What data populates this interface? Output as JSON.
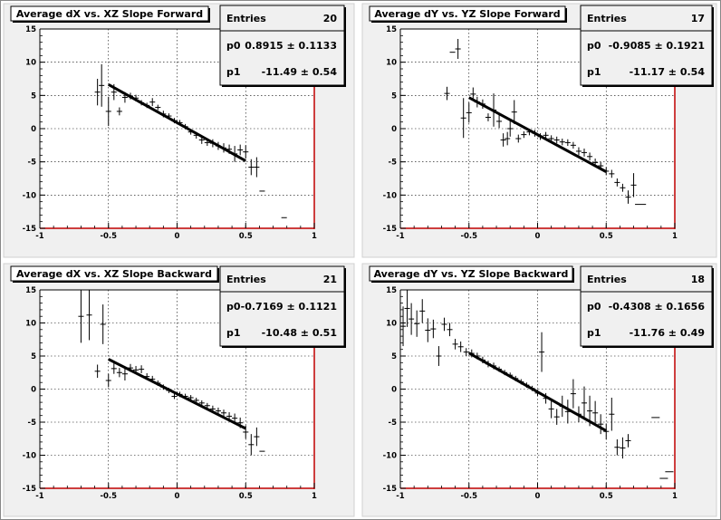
{
  "colors": {
    "pad_background": "#f0f0f0",
    "frame_background": "#ffffff",
    "axis_line": "#000000",
    "frame_right_bottom": "#c00000",
    "grid": "#000000",
    "fit_line": "#000000",
    "box_border": "#000000"
  },
  "chart_data": [
    {
      "type": "scatter",
      "title": "Average dX vs. XZ Slope Forward",
      "xlim": [
        -1,
        1
      ],
      "ylim": [
        -15,
        15
      ],
      "xticks": [
        -1,
        -0.5,
        0,
        0.5,
        1
      ],
      "yticks": [
        -15,
        -10,
        -5,
        0,
        5,
        10,
        15
      ],
      "grid": true,
      "stats": {
        "entries_label": "Entries",
        "entries_value": "20",
        "p0_label": "p0",
        "p0_value": "0.8915 ± 0.1133",
        "p1_label": "p1",
        "p1_value": "-11.49 ± 0.54"
      },
      "fit": {
        "x_start": -0.5,
        "x_end": 0.5,
        "p0": 0.8915,
        "p1": -11.49
      },
      "points": [
        {
          "x": -0.58,
          "y": 5.5,
          "ex": 0.02,
          "ey": 2.0
        },
        {
          "x": -0.55,
          "y": 6.5,
          "ex": 0.02,
          "ey": 3.2
        },
        {
          "x": -0.5,
          "y": 2.6,
          "ex": 0.02,
          "ey": 2.2
        },
        {
          "x": -0.46,
          "y": 5.5,
          "ex": 0.02,
          "ey": 1.2
        },
        {
          "x": -0.42,
          "y": 2.6,
          "ex": 0.02,
          "ey": 0.6
        },
        {
          "x": -0.38,
          "y": 4.7,
          "ex": 0.02,
          "ey": 0.8
        },
        {
          "x": -0.34,
          "y": 4.9,
          "ex": 0.02,
          "ey": 0.5
        },
        {
          "x": -0.3,
          "y": 4.6,
          "ex": 0.02,
          "ey": 0.5
        },
        {
          "x": -0.26,
          "y": 3.9,
          "ex": 0.02,
          "ey": 0.4
        },
        {
          "x": -0.22,
          "y": 3.5,
          "ex": 0.02,
          "ey": 0.4
        },
        {
          "x": -0.18,
          "y": 4.0,
          "ex": 0.02,
          "ey": 0.6
        },
        {
          "x": -0.14,
          "y": 3.2,
          "ex": 0.02,
          "ey": 0.4
        },
        {
          "x": -0.1,
          "y": 2.2,
          "ex": 0.02,
          "ey": 0.5
        },
        {
          "x": -0.06,
          "y": 1.9,
          "ex": 0.02,
          "ey": 0.4
        },
        {
          "x": -0.02,
          "y": 1.2,
          "ex": 0.02,
          "ey": 0.4
        },
        {
          "x": 0.02,
          "y": 0.9,
          "ex": 0.02,
          "ey": 0.4
        },
        {
          "x": 0.06,
          "y": 0.3,
          "ex": 0.02,
          "ey": 0.4
        },
        {
          "x": 0.1,
          "y": -0.5,
          "ex": 0.02,
          "ey": 0.4
        },
        {
          "x": 0.14,
          "y": -1.0,
          "ex": 0.02,
          "ey": 0.5
        },
        {
          "x": 0.18,
          "y": -1.7,
          "ex": 0.02,
          "ey": 0.6
        },
        {
          "x": 0.22,
          "y": -2.1,
          "ex": 0.02,
          "ey": 0.5
        },
        {
          "x": 0.26,
          "y": -2.2,
          "ex": 0.02,
          "ey": 0.6
        },
        {
          "x": 0.3,
          "y": -2.6,
          "ex": 0.02,
          "ey": 0.6
        },
        {
          "x": 0.34,
          "y": -2.9,
          "ex": 0.02,
          "ey": 0.7
        },
        {
          "x": 0.38,
          "y": -3.1,
          "ex": 0.02,
          "ey": 0.7
        },
        {
          "x": 0.42,
          "y": -3.8,
          "ex": 0.02,
          "ey": 1.2
        },
        {
          "x": 0.46,
          "y": -3.2,
          "ex": 0.02,
          "ey": 0.8
        },
        {
          "x": 0.5,
          "y": -3.5,
          "ex": 0.02,
          "ey": 1.0
        },
        {
          "x": 0.54,
          "y": -5.8,
          "ex": 0.02,
          "ey": 1.2
        },
        {
          "x": 0.58,
          "y": -5.8,
          "ex": 0.02,
          "ey": 1.5
        },
        {
          "x": 0.62,
          "y": -9.4,
          "ex": 0.02,
          "ey": 0.0
        },
        {
          "x": 0.78,
          "y": -13.4,
          "ex": 0.02,
          "ey": 0.0
        }
      ]
    },
    {
      "type": "scatter",
      "title": "Average dY vs. YZ Slope Forward",
      "xlim": [
        -1,
        1
      ],
      "ylim": [
        -15,
        15
      ],
      "xticks": [
        -1,
        -0.5,
        0,
        0.5,
        1
      ],
      "yticks": [
        -15,
        -10,
        -5,
        0,
        5,
        10,
        15
      ],
      "grid": true,
      "stats": {
        "entries_label": "Entries",
        "entries_value": "17",
        "p0_label": "p0",
        "p0_value": "-0.9085 ± 0.1921",
        "p1_label": "p1",
        "p1_value": "-11.17 ± 0.54"
      },
      "fit": {
        "x_start": -0.5,
        "x_end": 0.5,
        "p0": -0.9085,
        "p1": -11.17
      },
      "points": [
        {
          "x": -0.66,
          "y": 5.3,
          "ex": 0.02,
          "ey": 1.0
        },
        {
          "x": -0.62,
          "y": 11.5,
          "ex": 0.02,
          "ey": 0.0
        },
        {
          "x": -0.58,
          "y": 12.0,
          "ex": 0.02,
          "ey": 1.5
        },
        {
          "x": -0.54,
          "y": 1.6,
          "ex": 0.02,
          "ey": 3.0
        },
        {
          "x": -0.5,
          "y": 2.4,
          "ex": 0.02,
          "ey": 1.5
        },
        {
          "x": -0.47,
          "y": 5.2,
          "ex": 0.02,
          "ey": 1.0
        },
        {
          "x": -0.44,
          "y": 4.0,
          "ex": 0.02,
          "ey": 0.8
        },
        {
          "x": -0.4,
          "y": 3.7,
          "ex": 0.02,
          "ey": 0.7
        },
        {
          "x": -0.36,
          "y": 1.7,
          "ex": 0.02,
          "ey": 0.6
        },
        {
          "x": -0.32,
          "y": 2.8,
          "ex": 0.02,
          "ey": 2.5
        },
        {
          "x": -0.28,
          "y": 1.1,
          "ex": 0.02,
          "ey": 1.0
        },
        {
          "x": -0.25,
          "y": -1.7,
          "ex": 0.02,
          "ey": 1.0
        },
        {
          "x": -0.22,
          "y": -1.5,
          "ex": 0.02,
          "ey": 1.0
        },
        {
          "x": -0.2,
          "y": 0.0,
          "ex": 0.02,
          "ey": 1.2
        },
        {
          "x": -0.17,
          "y": 2.5,
          "ex": 0.02,
          "ey": 1.8
        },
        {
          "x": -0.14,
          "y": -1.5,
          "ex": 0.02,
          "ey": 0.6
        },
        {
          "x": -0.1,
          "y": -0.9,
          "ex": 0.02,
          "ey": 0.5
        },
        {
          "x": -0.06,
          "y": -0.5,
          "ex": 0.02,
          "ey": 0.5
        },
        {
          "x": -0.02,
          "y": -0.7,
          "ex": 0.02,
          "ey": 0.5
        },
        {
          "x": 0.02,
          "y": -1.2,
          "ex": 0.02,
          "ey": 0.5
        },
        {
          "x": 0.06,
          "y": -1.0,
          "ex": 0.02,
          "ey": 0.5
        },
        {
          "x": 0.1,
          "y": -1.5,
          "ex": 0.02,
          "ey": 0.5
        },
        {
          "x": 0.14,
          "y": -1.7,
          "ex": 0.02,
          "ey": 0.5
        },
        {
          "x": 0.18,
          "y": -2.0,
          "ex": 0.02,
          "ey": 0.5
        },
        {
          "x": 0.22,
          "y": -2.1,
          "ex": 0.02,
          "ey": 0.5
        },
        {
          "x": 0.26,
          "y": -2.5,
          "ex": 0.02,
          "ey": 0.5
        },
        {
          "x": 0.3,
          "y": -3.4,
          "ex": 0.02,
          "ey": 0.6
        },
        {
          "x": 0.34,
          "y": -3.6,
          "ex": 0.02,
          "ey": 0.6
        },
        {
          "x": 0.38,
          "y": -4.2,
          "ex": 0.02,
          "ey": 0.6
        },
        {
          "x": 0.42,
          "y": -5.1,
          "ex": 0.02,
          "ey": 0.6
        },
        {
          "x": 0.46,
          "y": -5.6,
          "ex": 0.02,
          "ey": 0.6
        },
        {
          "x": 0.5,
          "y": -6.4,
          "ex": 0.02,
          "ey": 0.6
        },
        {
          "x": 0.54,
          "y": -6.8,
          "ex": 0.02,
          "ey": 0.6
        },
        {
          "x": 0.58,
          "y": -8.1,
          "ex": 0.02,
          "ey": 0.6
        },
        {
          "x": 0.62,
          "y": -8.9,
          "ex": 0.02,
          "ey": 0.6
        },
        {
          "x": 0.66,
          "y": -10.3,
          "ex": 0.02,
          "ey": 1.0
        },
        {
          "x": 0.7,
          "y": -8.5,
          "ex": 0.02,
          "ey": 1.8
        },
        {
          "x": 0.75,
          "y": -11.4,
          "ex": 0.04,
          "ey": 0.0
        }
      ]
    },
    {
      "type": "scatter",
      "title": "Average dX vs. XZ Slope Backward",
      "xlim": [
        -1,
        1
      ],
      "ylim": [
        -15,
        15
      ],
      "xticks": [
        -1,
        -0.5,
        0,
        0.5,
        1
      ],
      "yticks": [
        -15,
        -10,
        -5,
        0,
        5,
        10,
        15
      ],
      "grid": true,
      "stats": {
        "entries_label": "Entries",
        "entries_value": "21",
        "p0_label": "p0",
        "p0_value": "-0.7169 ± 0.1121",
        "p1_label": "p1",
        "p1_value": "-10.48 ± 0.51"
      },
      "fit": {
        "x_start": -0.5,
        "x_end": 0.5,
        "p0": -0.7169,
        "p1": -10.48
      },
      "points": [
        {
          "x": -0.7,
          "y": 11.0,
          "ex": 0.02,
          "ey": 4.0
        },
        {
          "x": -0.64,
          "y": 11.2,
          "ex": 0.02,
          "ey": 3.8
        },
        {
          "x": -0.58,
          "y": 2.7,
          "ex": 0.02,
          "ey": 1.0
        },
        {
          "x": -0.54,
          "y": 9.8,
          "ex": 0.02,
          "ey": 3.0
        },
        {
          "x": -0.5,
          "y": 1.3,
          "ex": 0.02,
          "ey": 1.0
        },
        {
          "x": -0.46,
          "y": 3.1,
          "ex": 0.02,
          "ey": 0.8
        },
        {
          "x": -0.42,
          "y": 2.5,
          "ex": 0.02,
          "ey": 0.7
        },
        {
          "x": -0.38,
          "y": 2.3,
          "ex": 0.02,
          "ey": 1.0
        },
        {
          "x": -0.34,
          "y": 3.2,
          "ex": 0.02,
          "ey": 0.6
        },
        {
          "x": -0.3,
          "y": 2.9,
          "ex": 0.02,
          "ey": 0.6
        },
        {
          "x": -0.26,
          "y": 3.0,
          "ex": 0.02,
          "ey": 0.6
        },
        {
          "x": -0.22,
          "y": 1.9,
          "ex": 0.02,
          "ey": 0.5
        },
        {
          "x": -0.18,
          "y": 1.5,
          "ex": 0.02,
          "ey": 0.5
        },
        {
          "x": -0.14,
          "y": 0.9,
          "ex": 0.02,
          "ey": 0.4
        },
        {
          "x": -0.1,
          "y": 0.3,
          "ex": 0.02,
          "ey": 0.4
        },
        {
          "x": -0.06,
          "y": -0.2,
          "ex": 0.02,
          "ey": 0.4
        },
        {
          "x": -0.02,
          "y": -1.1,
          "ex": 0.02,
          "ey": 0.4
        },
        {
          "x": 0.02,
          "y": -0.8,
          "ex": 0.02,
          "ey": 0.4
        },
        {
          "x": 0.06,
          "y": -1.1,
          "ex": 0.02,
          "ey": 0.4
        },
        {
          "x": 0.1,
          "y": -1.3,
          "ex": 0.02,
          "ey": 0.4
        },
        {
          "x": 0.14,
          "y": -1.7,
          "ex": 0.02,
          "ey": 0.4
        },
        {
          "x": 0.18,
          "y": -2.1,
          "ex": 0.02,
          "ey": 0.4
        },
        {
          "x": 0.22,
          "y": -2.5,
          "ex": 0.02,
          "ey": 0.4
        },
        {
          "x": 0.26,
          "y": -3.0,
          "ex": 0.02,
          "ey": 0.5
        },
        {
          "x": 0.3,
          "y": -3.3,
          "ex": 0.02,
          "ey": 0.5
        },
        {
          "x": 0.34,
          "y": -3.6,
          "ex": 0.02,
          "ey": 0.5
        },
        {
          "x": 0.38,
          "y": -4.1,
          "ex": 0.02,
          "ey": 0.6
        },
        {
          "x": 0.42,
          "y": -4.4,
          "ex": 0.02,
          "ey": 0.7
        },
        {
          "x": 0.46,
          "y": -5.1,
          "ex": 0.02,
          "ey": 0.8
        },
        {
          "x": 0.5,
          "y": -6.5,
          "ex": 0.02,
          "ey": 1.0
        },
        {
          "x": 0.54,
          "y": -8.4,
          "ex": 0.02,
          "ey": 1.6
        },
        {
          "x": 0.58,
          "y": -7.2,
          "ex": 0.02,
          "ey": 1.4
        },
        {
          "x": 0.62,
          "y": -9.4,
          "ex": 0.02,
          "ey": 0.0
        }
      ]
    },
    {
      "type": "scatter",
      "title": "Average dY vs. YZ Slope Backward",
      "xlim": [
        -1,
        1
      ],
      "ylim": [
        -15,
        15
      ],
      "xticks": [
        -1,
        -0.5,
        0,
        0.5,
        1
      ],
      "yticks": [
        -15,
        -10,
        -5,
        0,
        5,
        10,
        15
      ],
      "grid": true,
      "stats": {
        "entries_label": "Entries",
        "entries_value": "18",
        "p0_label": "p0",
        "p0_value": "-0.4308 ± 0.1656",
        "p1_label": "p1",
        "p1_value": "-11.76 ± 0.49"
      },
      "fit": {
        "x_start": -0.5,
        "x_end": 0.5,
        "p0": -0.4308,
        "p1": -11.76
      },
      "points": [
        {
          "x": -0.98,
          "y": 9.5,
          "ex": 0.02,
          "ey": 3.0
        },
        {
          "x": -0.95,
          "y": 12.2,
          "ex": 0.02,
          "ey": 2.8
        },
        {
          "x": -0.92,
          "y": 10.6,
          "ex": 0.02,
          "ey": 2.4
        },
        {
          "x": -0.88,
          "y": 9.9,
          "ex": 0.02,
          "ey": 2.0
        },
        {
          "x": -0.84,
          "y": 11.8,
          "ex": 0.02,
          "ey": 1.8
        },
        {
          "x": -0.8,
          "y": 8.9,
          "ex": 0.02,
          "ey": 1.8
        },
        {
          "x": -0.76,
          "y": 9.1,
          "ex": 0.02,
          "ey": 1.4
        },
        {
          "x": -0.72,
          "y": 5.0,
          "ex": 0.02,
          "ey": 1.5
        },
        {
          "x": -0.68,
          "y": 9.8,
          "ex": 0.02,
          "ey": 1.0
        },
        {
          "x": -0.64,
          "y": 9.0,
          "ex": 0.02,
          "ey": 1.0
        },
        {
          "x": -0.6,
          "y": 6.8,
          "ex": 0.02,
          "ey": 0.8
        },
        {
          "x": -0.56,
          "y": 6.4,
          "ex": 0.02,
          "ey": 0.8
        },
        {
          "x": -0.52,
          "y": 5.6,
          "ex": 0.02,
          "ey": 0.6
        },
        {
          "x": -0.48,
          "y": 5.4,
          "ex": 0.02,
          "ey": 0.6
        },
        {
          "x": -0.44,
          "y": 5.0,
          "ex": 0.02,
          "ey": 0.5
        },
        {
          "x": -0.4,
          "y": 4.4,
          "ex": 0.02,
          "ey": 0.5
        },
        {
          "x": -0.36,
          "y": 3.8,
          "ex": 0.02,
          "ey": 0.5
        },
        {
          "x": -0.32,
          "y": 3.5,
          "ex": 0.02,
          "ey": 0.5
        },
        {
          "x": -0.28,
          "y": 3.0,
          "ex": 0.02,
          "ey": 0.4
        },
        {
          "x": -0.24,
          "y": 2.5,
          "ex": 0.02,
          "ey": 0.4
        },
        {
          "x": -0.2,
          "y": 2.1,
          "ex": 0.02,
          "ey": 0.4
        },
        {
          "x": -0.16,
          "y": 1.6,
          "ex": 0.02,
          "ey": 0.4
        },
        {
          "x": -0.12,
          "y": 1.1,
          "ex": 0.02,
          "ey": 0.4
        },
        {
          "x": -0.08,
          "y": 0.6,
          "ex": 0.02,
          "ey": 0.4
        },
        {
          "x": -0.04,
          "y": 0.1,
          "ex": 0.02,
          "ey": 0.4
        },
        {
          "x": 0.0,
          "y": -0.6,
          "ex": 0.02,
          "ey": 0.5
        },
        {
          "x": 0.03,
          "y": 5.6,
          "ex": 0.02,
          "ey": 3.0
        },
        {
          "x": 0.06,
          "y": -1.4,
          "ex": 0.02,
          "ey": 0.8
        },
        {
          "x": 0.1,
          "y": -3.0,
          "ex": 0.02,
          "ey": 1.4
        },
        {
          "x": 0.14,
          "y": -4.2,
          "ex": 0.02,
          "ey": 1.2
        },
        {
          "x": 0.18,
          "y": -2.6,
          "ex": 0.02,
          "ey": 1.6
        },
        {
          "x": 0.22,
          "y": -3.4,
          "ex": 0.02,
          "ey": 1.8
        },
        {
          "x": 0.26,
          "y": -0.7,
          "ex": 0.02,
          "ey": 2.2
        },
        {
          "x": 0.3,
          "y": -3.8,
          "ex": 0.02,
          "ey": 1.2
        },
        {
          "x": 0.34,
          "y": -2.1,
          "ex": 0.02,
          "ey": 2.5
        },
        {
          "x": 0.38,
          "y": -3.3,
          "ex": 0.02,
          "ey": 2.3
        },
        {
          "x": 0.42,
          "y": -3.6,
          "ex": 0.02,
          "ey": 1.8
        },
        {
          "x": 0.46,
          "y": -5.3,
          "ex": 0.02,
          "ey": 1.5
        },
        {
          "x": 0.5,
          "y": -6.4,
          "ex": 0.02,
          "ey": 1.2
        },
        {
          "x": 0.54,
          "y": -3.8,
          "ex": 0.02,
          "ey": 2.5
        },
        {
          "x": 0.58,
          "y": -8.8,
          "ex": 0.02,
          "ey": 1.2
        },
        {
          "x": 0.62,
          "y": -8.9,
          "ex": 0.02,
          "ey": 1.6
        },
        {
          "x": 0.66,
          "y": -7.8,
          "ex": 0.02,
          "ey": 1.0
        },
        {
          "x": 0.86,
          "y": -4.3,
          "ex": 0.03,
          "ey": 0.0
        },
        {
          "x": 0.92,
          "y": -13.5,
          "ex": 0.03,
          "ey": 0.0
        },
        {
          "x": 0.96,
          "y": -12.5,
          "ex": 0.03,
          "ey": 0.0
        }
      ]
    }
  ]
}
